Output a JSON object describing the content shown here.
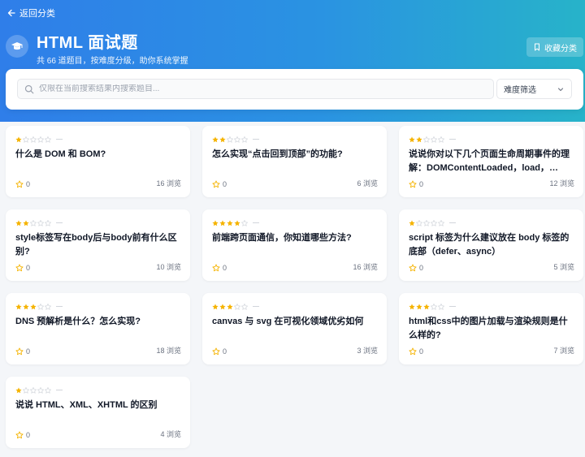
{
  "header": {
    "back_label": "返回分类",
    "title": "HTML 面试题",
    "subtitle": "共 66 道题目，按难度分级，助你系统掌握",
    "favorite_label": "收藏分类"
  },
  "search": {
    "placeholder": "仅限在当前搜索结果内搜索题目...",
    "difficulty_label": "难度筛选"
  },
  "colors": {
    "star_filled": "#f5b301",
    "star_empty": "#d1d5db",
    "header_start": "#2f7ee9",
    "header_end": "#27b3c9"
  },
  "views_suffix": "浏览",
  "questions": [
    {
      "stars": 1,
      "title": "什么是 DOM 和 BOM?",
      "favorites": "0",
      "views": "16 浏览"
    },
    {
      "stars": 2,
      "title": "怎么实现“点击回到顶部”的功能?",
      "favorites": "0",
      "views": "6 浏览"
    },
    {
      "stars": 2,
      "title": "说说你对以下几个页面生命周期事件的理解：DOMContentLoaded，load，beforeunload，unload",
      "favorites": "0",
      "views": "12 浏览"
    },
    {
      "stars": 2,
      "title": "style标签写在body后与body前有什么区别?",
      "favorites": "0",
      "views": "10 浏览"
    },
    {
      "stars": 4,
      "title": "前端跨页面通信，你知道哪些方法?",
      "favorites": "0",
      "views": "16 浏览"
    },
    {
      "stars": 1,
      "title": "script 标签为什么建议放在 body 标签的底部（defer、async）",
      "favorites": "0",
      "views": "5 浏览"
    },
    {
      "stars": 3,
      "title": "DNS 预解析是什么？怎么实现?",
      "favorites": "0",
      "views": "18 浏览"
    },
    {
      "stars": 3,
      "title": "canvas 与 svg 在可视化领域优劣如何",
      "favorites": "0",
      "views": "3 浏览"
    },
    {
      "stars": 3,
      "title": "html和css中的图片加载与渲染规则是什么样的?",
      "favorites": "0",
      "views": "7 浏览"
    },
    {
      "stars": 1,
      "title": "说说 HTML、XML、XHTML 的区别",
      "favorites": "0",
      "views": "4 浏览"
    }
  ]
}
